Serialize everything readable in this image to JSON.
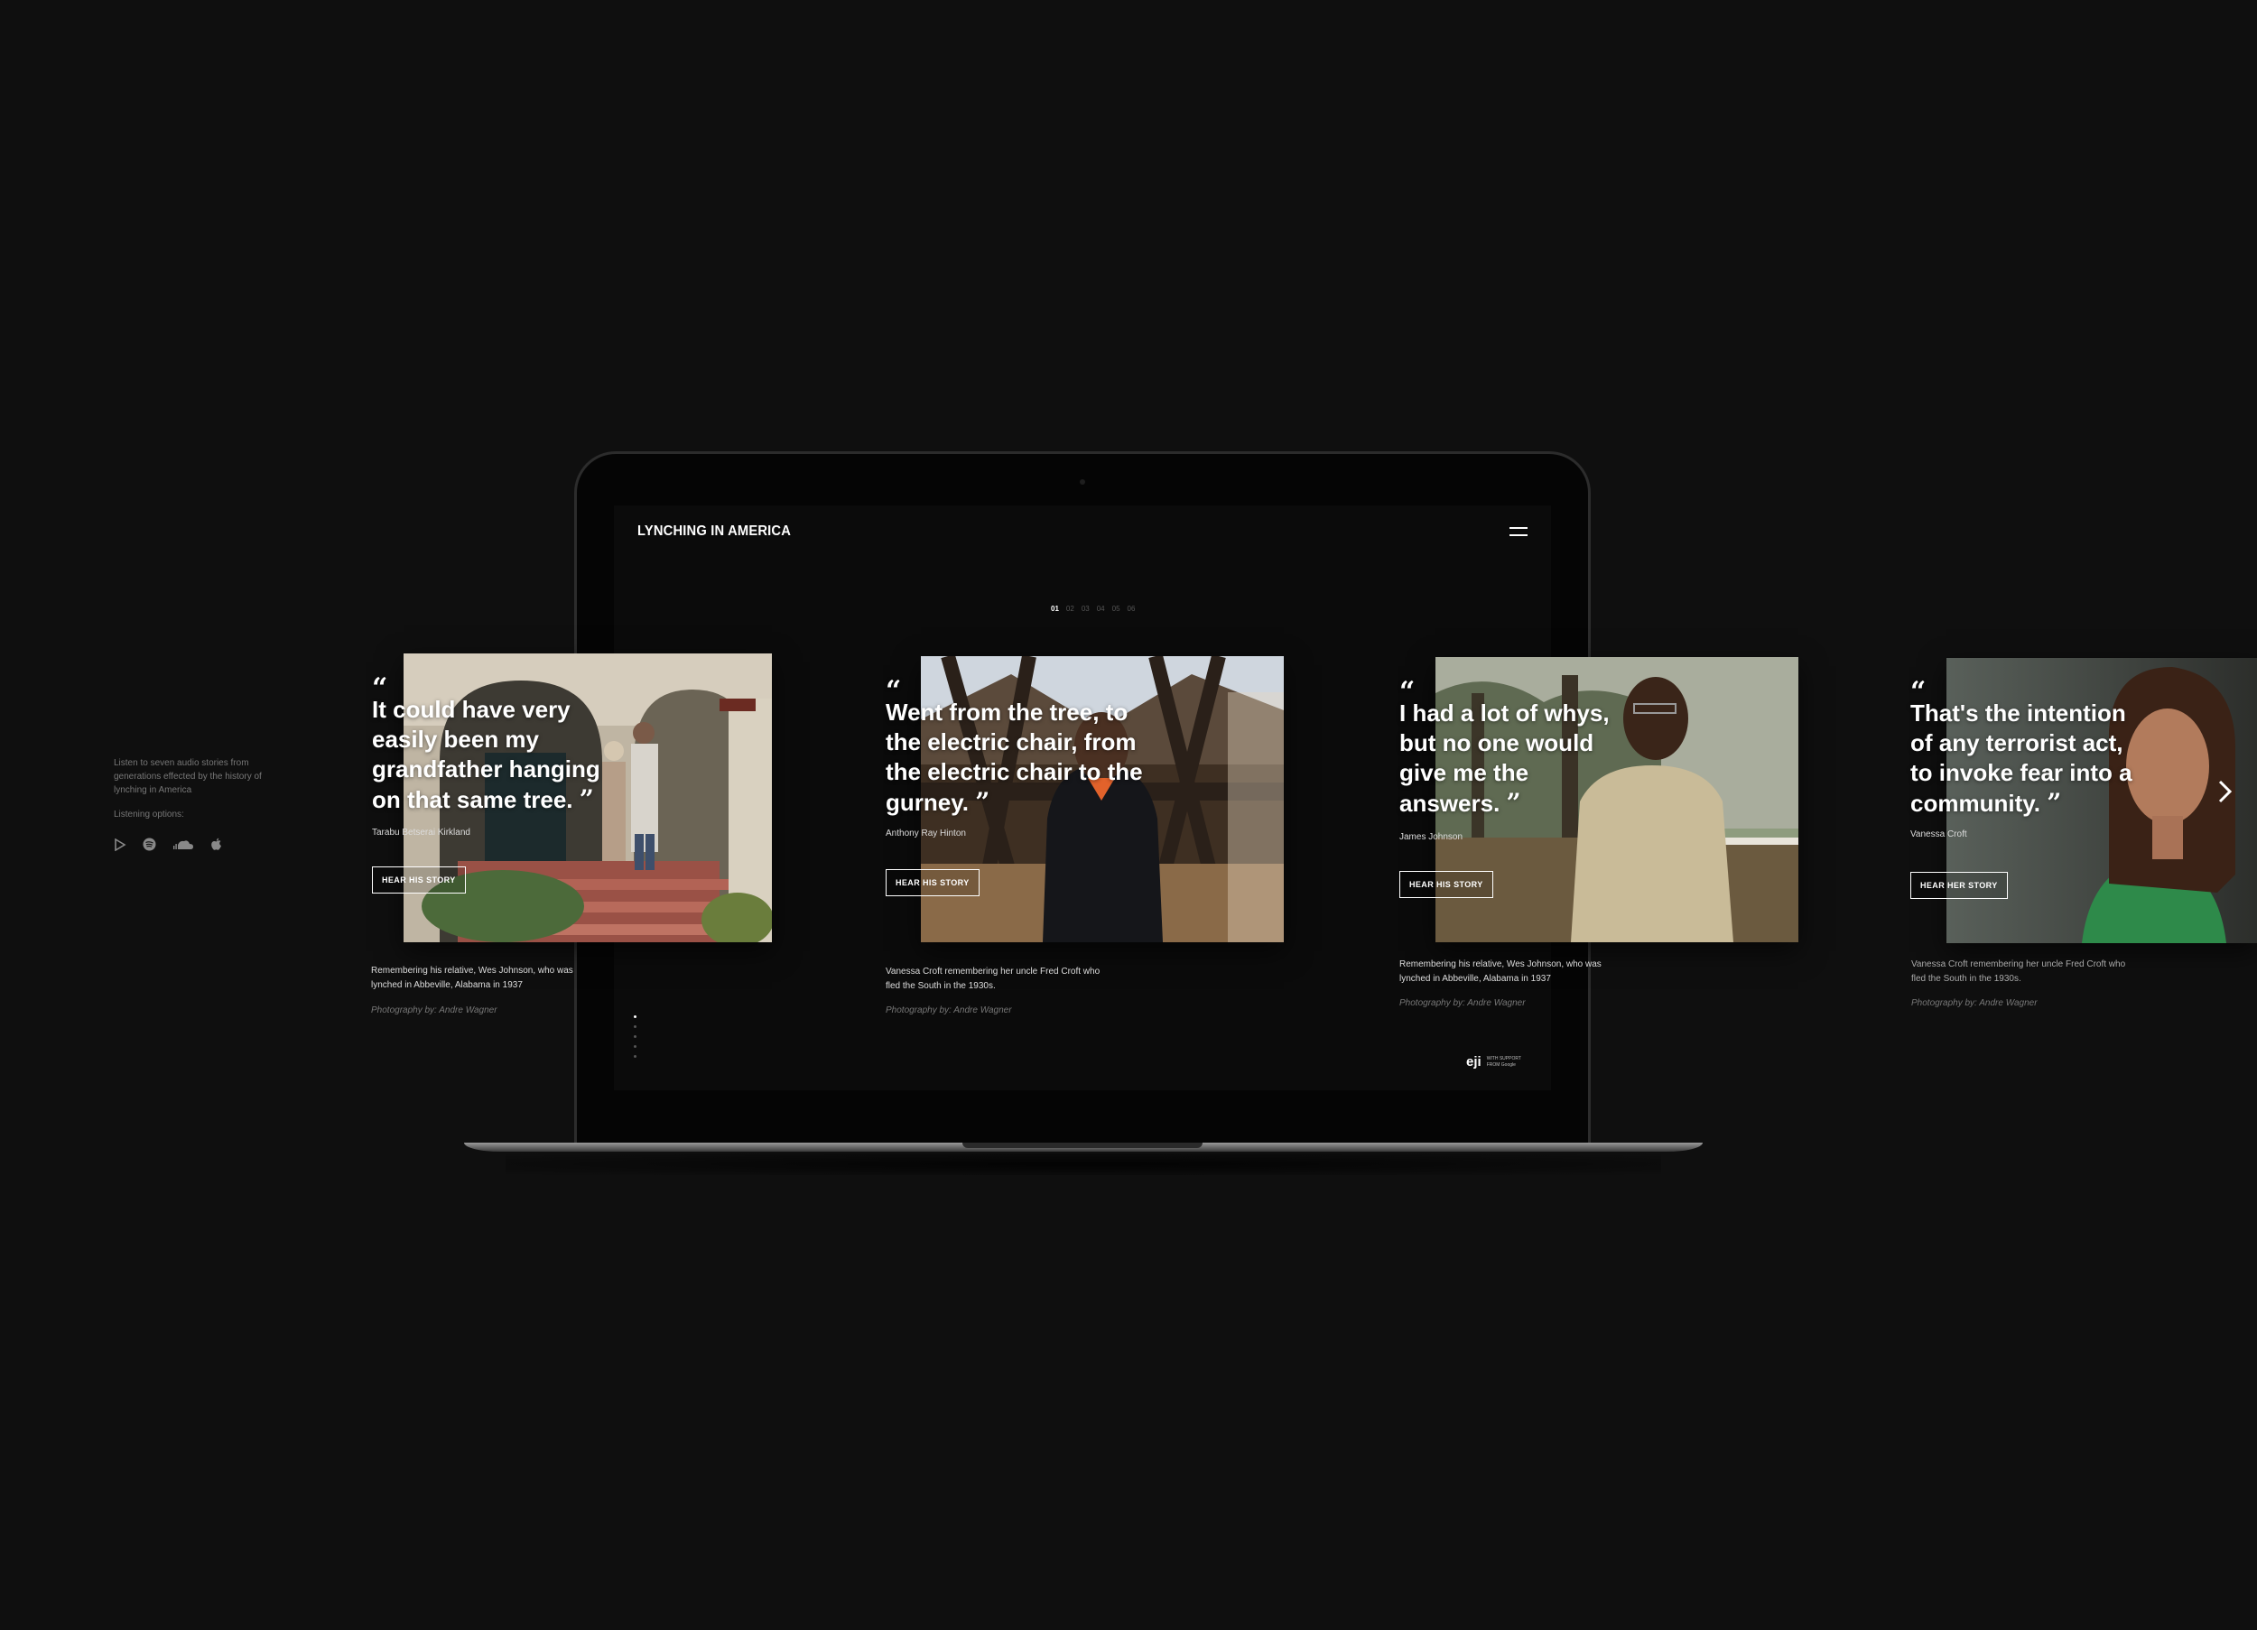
{
  "site": {
    "logo": "LYNCHING IN AMERICA",
    "pager": [
      "01",
      "02",
      "03",
      "04",
      "05",
      "06"
    ],
    "sponsor": {
      "logo": "eji",
      "line1": "WITH SUPPORT",
      "line2": "FROM Google"
    }
  },
  "intro": {
    "text": "Listen to seven audio stories from generations effected by the history of lynching in America",
    "options_label": "Listening options:",
    "platforms": [
      "google-play-icon",
      "spotify-icon",
      "soundcloud-icon",
      "apple-icon"
    ]
  },
  "stories": [
    {
      "quote": "It could have very easily been my grandfather hanging on that same tree.",
      "person": "Tarabu Betserai Kirkland",
      "cta": "HEAR HIS STORY",
      "caption": "Remembering his relative, Wes Johnson, who was lynched in Abbeville, Alabama in 1937",
      "credit": "Photography by: Andre Wagner"
    },
    {
      "quote": "Went from the tree, to the electric chair, from the electric chair to the gurney.",
      "person": "Anthony Ray Hinton",
      "cta": "HEAR HIS STORY",
      "caption": "Vanessa Croft remembering her uncle Fred Croft who fled the South in the 1930s.",
      "credit": "Photography by: Andre Wagner"
    },
    {
      "quote": "I had a lot of whys, but no one would give me the answers.",
      "person": "James Johnson",
      "cta": "HEAR HIS STORY",
      "caption": "Remembering his relative, Wes Johnson, who was lynched in Abbeville, Alabama in 1937",
      "credit": "Photography by: Andre Wagner"
    },
    {
      "quote": "That's the intention of any terrorist act, to invoke fear into a community.",
      "person": "Vanessa Croft",
      "cta": "HEAR HER STORY",
      "caption": "Vanessa Croft remembering her uncle Fred Croft who fled the South in the 1930s.",
      "credit": "Photography by: Andre Wagner"
    }
  ],
  "colors": {
    "background": "#0f0f0f",
    "screen": "#0b0b0b",
    "text": "#ffffff",
    "muted": "#777777"
  }
}
